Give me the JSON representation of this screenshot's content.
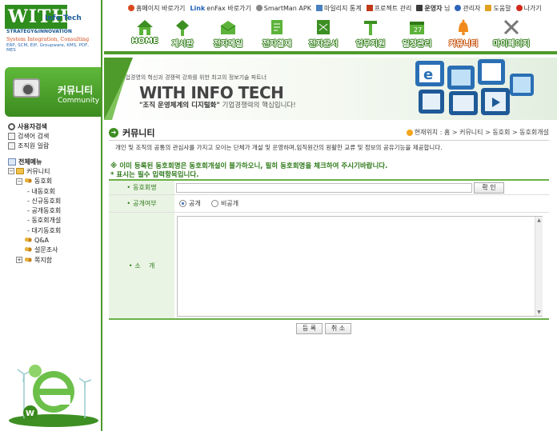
{
  "logo": {
    "with": "WITH",
    "info_tech": "Info Tech",
    "strategy": "STRATEGY&INNOVATION",
    "system": "System Integration, Consulting",
    "products": "ERP, SCM, EIP, Groupware, KMS, PDF, MES"
  },
  "top_links": [
    {
      "label": "홈페이지 바로가기",
      "icon": "home-icon",
      "color": "#d9481c"
    },
    {
      "label": "enFax 바로가기",
      "prefix": "Link",
      "icon": "fax-icon",
      "color": "#1e5fb4"
    },
    {
      "label": "SmartMan APK",
      "icon": "smartman-icon",
      "color": "#888888"
    },
    {
      "label": "마일리지 통계",
      "icon": "chart-icon",
      "color": "#4a7fc0"
    },
    {
      "label": "프로젝트 관리",
      "icon": "project-icon",
      "color": "#c03a1a"
    },
    {
      "label": "운영자",
      "suffix": "님",
      "icon": "user-icon",
      "color": "#3a3a3a"
    },
    {
      "label": "관리자",
      "icon": "admin-icon",
      "color": "#2d66b8"
    },
    {
      "label": "도움말",
      "icon": "help-icon",
      "color": "#e0a020"
    },
    {
      "label": "나가기",
      "icon": "logout-icon",
      "color": "#d02a1a"
    }
  ],
  "menu": [
    {
      "label": "HOME",
      "icon": "home-house-icon"
    },
    {
      "label": "게시판",
      "icon": "board-icon"
    },
    {
      "label": "전자메일",
      "icon": "mail-icon"
    },
    {
      "label": "전자결재",
      "icon": "approval-icon"
    },
    {
      "label": "전자문서",
      "icon": "document-icon"
    },
    {
      "label": "업무지원",
      "icon": "support-icon"
    },
    {
      "label": "일정관리",
      "icon": "calendar-icon"
    },
    {
      "label": "커뮤니티",
      "icon": "community-bell-icon",
      "active": true
    },
    {
      "label": "마이페이지",
      "icon": "tools-icon"
    }
  ],
  "hero": {
    "tagline": "기업경영의 혁신과 경쟁력 강화를 위한 최고의 정보기술 파트너",
    "brand": "WITH INFO TECH",
    "slogan_bold": "\"조직 운영체계의 디지털화\"",
    "slogan_rest": " 기업경쟁력의 핵심입니다!"
  },
  "sidebar": {
    "banner_title": "커뮤니티",
    "banner_sub": "Community",
    "quick": [
      {
        "label": "사용자검색",
        "icon": "search-icon",
        "bold": true
      },
      {
        "label": "검색어 검색",
        "icon": "doc-search-icon"
      },
      {
        "label": "조직원 일람",
        "icon": "org-list-icon"
      }
    ],
    "tree_root": "전체메뉴",
    "tree": [
      {
        "label": "커뮤니티",
        "level": 0,
        "toggle": "−",
        "icon": "folder"
      },
      {
        "label": "동호회",
        "level": 1,
        "toggle": "−",
        "icon": "people"
      },
      {
        "label": "내동호회",
        "level": 2
      },
      {
        "label": "신규동호회",
        "level": 2
      },
      {
        "label": "공개동호회",
        "level": 2
      },
      {
        "label": "동호회개설",
        "level": 2
      },
      {
        "label": "대기동호회",
        "level": 2
      },
      {
        "label": "Q&A",
        "level": 1,
        "icon": "people"
      },
      {
        "label": "설문조사",
        "level": 1,
        "icon": "people"
      },
      {
        "label": "쪽지함",
        "level": 1,
        "toggle": "+",
        "icon": "people"
      }
    ]
  },
  "page": {
    "title": "커뮤니티",
    "breadcrumb": "현재위치 : 홈 > 커뮤니티 > 동호회 > 동호회개설",
    "description": "개인 및 조직의 공통의 관심사를 가지고 모이는 단체가 개설 및 운영하며,임직원간의 원활한 교류 및 정보의 공유기능을 제공합니다.",
    "notice1": "※ 이미 등록된 동호회명은 동호회개설이 불가하오니, 필히 동호회명을 체크하여 주시기바랍니다.",
    "notice2": "* 표시는 필수 입력항목입니다.",
    "form": {
      "name_label": "동호회명",
      "name_value": "",
      "check_button": "확 인",
      "public_label": "공개여부",
      "public_option": "공개",
      "private_option": "비공개",
      "intro_label": "소    개",
      "intro_value": ""
    },
    "buttons": {
      "register": "등 록",
      "cancel": "취 소"
    }
  },
  "colors": {
    "brand_green": "#4e9a2a",
    "label_green": "#2e7a1a",
    "active_orange": "#f08a1c"
  }
}
